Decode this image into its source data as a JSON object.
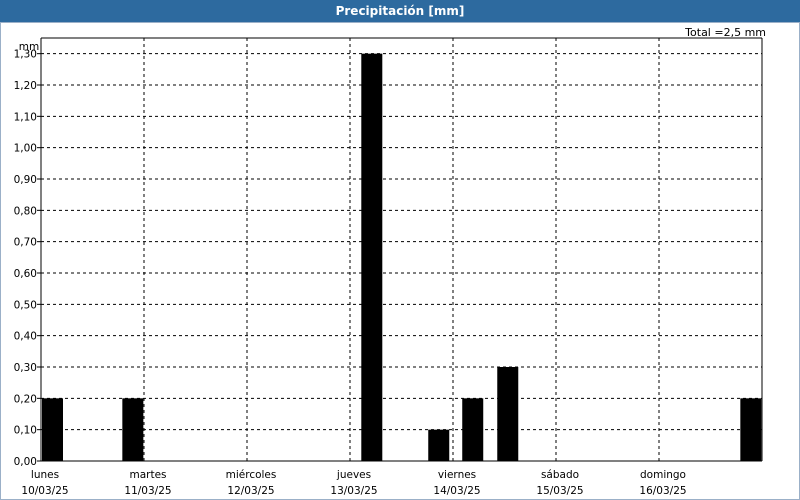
{
  "window": {
    "title": "Precipitación [mm]",
    "total_label": "Total =2,5 mm"
  },
  "colors": {
    "title_bar": "#2d6a9f",
    "bar": "#000000",
    "grid": "#000000",
    "background": "#ffffff"
  },
  "chart_data": {
    "type": "bar",
    "title": "Precipitación [mm]",
    "ylabel": "mm",
    "xlabel": "",
    "ylim": [
      0,
      1.35
    ],
    "yticks": [
      "0,00",
      "0,10",
      "0,20",
      "0,30",
      "0,40",
      "0,50",
      "0,60",
      "0,70",
      "0,80",
      "0,90",
      "1,00",
      "1,10",
      "1,20",
      "1,30"
    ],
    "grid": true,
    "days": [
      {
        "name": "lunes",
        "date": "10/03/25"
      },
      {
        "name": "martes",
        "date": "11/03/25"
      },
      {
        "name": "miércoles",
        "date": "12/03/25"
      },
      {
        "name": "jueves",
        "date": "13/03/25"
      },
      {
        "name": "viernes",
        "date": "14/03/25"
      },
      {
        "name": "sábado",
        "date": "15/03/25"
      },
      {
        "name": "domingo",
        "date": "16/03/25"
      }
    ],
    "bars": [
      {
        "day": 0.0,
        "value": 0.2
      },
      {
        "day": 0.78,
        "value": 0.2
      },
      {
        "day": 3.1,
        "value": 1.3
      },
      {
        "day": 3.75,
        "value": 0.1
      },
      {
        "day": 4.08,
        "value": 0.2
      },
      {
        "day": 4.42,
        "value": 0.3
      },
      {
        "day": 6.78,
        "value": 0.2
      }
    ],
    "total": "2,5"
  }
}
